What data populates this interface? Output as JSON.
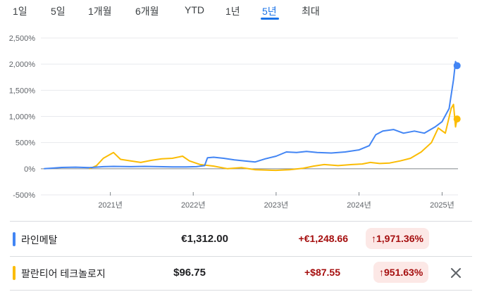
{
  "tabs": [
    {
      "label": "1일",
      "active": false
    },
    {
      "label": "5일",
      "active": false
    },
    {
      "label": "1개월",
      "active": false
    },
    {
      "label": "6개월",
      "active": false
    },
    {
      "label": "YTD",
      "active": false
    },
    {
      "label": "1년",
      "active": false
    },
    {
      "label": "5년",
      "active": true
    },
    {
      "label": "최대",
      "active": false
    }
  ],
  "chart_data": {
    "type": "line",
    "title": "",
    "xlabel": "",
    "ylabel": "",
    "x_ticks": [
      "2021년",
      "2022년",
      "2023년",
      "2024년",
      "2025년"
    ],
    "y_ticks": [
      "2,500%",
      "2,000%",
      "1,500%",
      "1,000%",
      "500%",
      "0%",
      "-500%"
    ],
    "ylim": [
      -500,
      2500
    ],
    "xlim": [
      "2020-03",
      "2025-03"
    ],
    "grid": true,
    "series": [
      {
        "name": "라인메탈",
        "color": "#4285f4",
        "points": [
          [
            "2020-03-15",
            0
          ],
          [
            "2020-04-15",
            10
          ],
          [
            "2020-06-01",
            25
          ],
          [
            "2020-08-01",
            30
          ],
          [
            "2020-10-01",
            20
          ],
          [
            "2020-12-01",
            40
          ],
          [
            "2021-01-15",
            45
          ],
          [
            "2021-04-01",
            40
          ],
          [
            "2021-06-01",
            45
          ],
          [
            "2021-08-01",
            40
          ],
          [
            "2021-10-01",
            35
          ],
          [
            "2021-12-01",
            35
          ],
          [
            "2022-01-15",
            40
          ],
          [
            "2022-02-20",
            60
          ],
          [
            "2022-03-05",
            210
          ],
          [
            "2022-04-01",
            220
          ],
          [
            "2022-05-15",
            200
          ],
          [
            "2022-07-01",
            170
          ],
          [
            "2022-08-15",
            150
          ],
          [
            "2022-10-01",
            130
          ],
          [
            "2022-11-15",
            190
          ],
          [
            "2023-01-01",
            240
          ],
          [
            "2023-02-15",
            320
          ],
          [
            "2023-04-01",
            310
          ],
          [
            "2023-05-15",
            330
          ],
          [
            "2023-07-01",
            310
          ],
          [
            "2023-09-01",
            300
          ],
          [
            "2023-11-01",
            320
          ],
          [
            "2024-01-01",
            360
          ],
          [
            "2024-02-15",
            440
          ],
          [
            "2024-03-15",
            650
          ],
          [
            "2024-04-15",
            720
          ],
          [
            "2024-06-01",
            750
          ],
          [
            "2024-07-15",
            680
          ],
          [
            "2024-09-01",
            720
          ],
          [
            "2024-10-15",
            680
          ],
          [
            "2024-12-01",
            800
          ],
          [
            "2025-01-01",
            900
          ],
          [
            "2025-02-01",
            1150
          ],
          [
            "2025-02-20",
            1700
          ],
          [
            "2025-03-01",
            2050
          ],
          [
            "2025-03-08",
            1971
          ]
        ]
      },
      {
        "name": "팔란티어 테크놀로지",
        "color": "#fbbc04",
        "points": [
          [
            "2020-10-01",
            0
          ],
          [
            "2020-11-01",
            60
          ],
          [
            "2020-12-01",
            200
          ],
          [
            "2021-01-15",
            310
          ],
          [
            "2021-02-15",
            180
          ],
          [
            "2021-04-01",
            150
          ],
          [
            "2021-05-15",
            120
          ],
          [
            "2021-07-01",
            160
          ],
          [
            "2021-08-15",
            190
          ],
          [
            "2021-10-01",
            200
          ],
          [
            "2021-11-15",
            240
          ],
          [
            "2021-12-15",
            150
          ],
          [
            "2022-02-01",
            80
          ],
          [
            "2022-04-01",
            50
          ],
          [
            "2022-06-01",
            0
          ],
          [
            "2022-08-01",
            20
          ],
          [
            "2022-10-01",
            -20
          ],
          [
            "2022-12-31",
            -30
          ],
          [
            "2023-03-01",
            -20
          ],
          [
            "2023-05-01",
            10
          ],
          [
            "2023-06-15",
            50
          ],
          [
            "2023-08-01",
            80
          ],
          [
            "2023-10-01",
            60
          ],
          [
            "2023-12-01",
            80
          ],
          [
            "2024-01-15",
            90
          ],
          [
            "2024-02-20",
            120
          ],
          [
            "2024-04-01",
            100
          ],
          [
            "2024-05-15",
            110
          ],
          [
            "2024-07-01",
            150
          ],
          [
            "2024-08-15",
            200
          ],
          [
            "2024-10-01",
            320
          ],
          [
            "2024-11-15",
            500
          ],
          [
            "2024-12-15",
            780
          ],
          [
            "2025-01-15",
            680
          ],
          [
            "2025-02-10",
            1150
          ],
          [
            "2025-02-20",
            1230
          ],
          [
            "2025-03-01",
            800
          ],
          [
            "2025-03-08",
            951
          ]
        ]
      }
    ]
  },
  "rows": [
    {
      "name": "라인메탈",
      "price": "€1,312.00",
      "change": "+€1,248.66",
      "pct": "1,971.36%",
      "color": "#4285f4"
    },
    {
      "name": "팔란티어 테크놀로지",
      "price": "$96.75",
      "change": "+$87.55",
      "pct": "951.63%",
      "color": "#fbbc04"
    }
  ],
  "icons": {
    "up_arrow": "arrow-up-icon",
    "close": "close-icon"
  }
}
